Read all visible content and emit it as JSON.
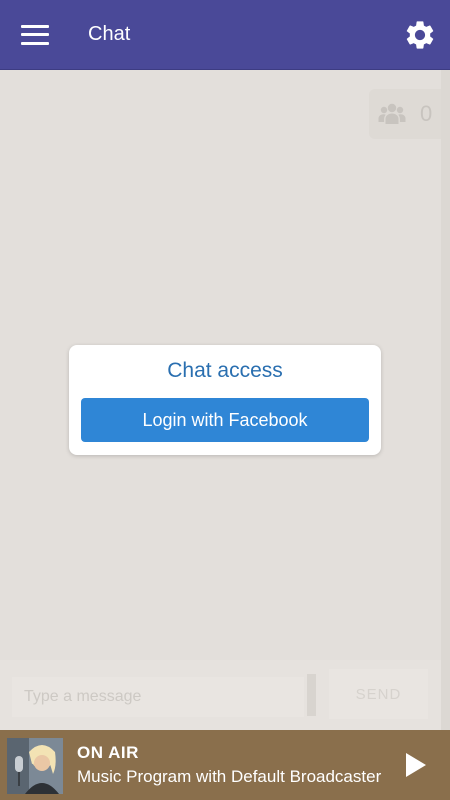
{
  "app_bar": {
    "title": "Chat",
    "menu_icon": "hamburger-menu-icon",
    "settings_icon": "gear-icon"
  },
  "users_badge": {
    "icon": "group-icon",
    "count": "0"
  },
  "access_card": {
    "title": "Chat access",
    "login_label": "Login with Facebook"
  },
  "composer": {
    "placeholder": "Type a message",
    "send_label": "SEND"
  },
  "player": {
    "status": "ON AIR",
    "program": "Music Program with Default Broadcaster",
    "play_icon": "play-icon"
  },
  "colors": {
    "app_bar": "#4a4998",
    "background": "#e3dfdb",
    "accent_button": "#2f86d6",
    "card_title": "#2a6fb0",
    "player_bar": "#8a6f4c"
  }
}
